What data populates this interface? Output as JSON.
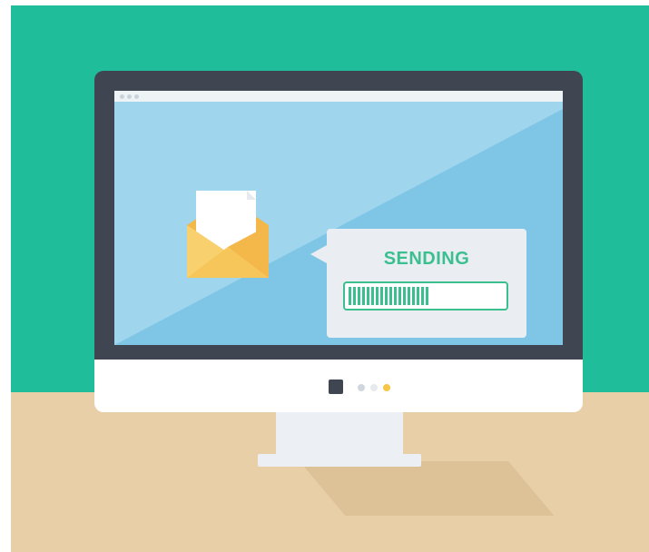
{
  "bubble": {
    "text": "SENDING",
    "progress_fraction": 0.52
  },
  "colors": {
    "wall": "#1fbd9a",
    "desk": "#e8cfa8",
    "monitor_frame": "#3f4652",
    "screen": "#7fc6e6",
    "accent": "#3bbf8f",
    "envelope": "#f6c65a"
  },
  "icons": {
    "envelope": "envelope-open-icon",
    "letter": "document-icon"
  },
  "chin_indicators": [
    "square",
    "gray-dot",
    "light-dot",
    "yellow-dot"
  ]
}
